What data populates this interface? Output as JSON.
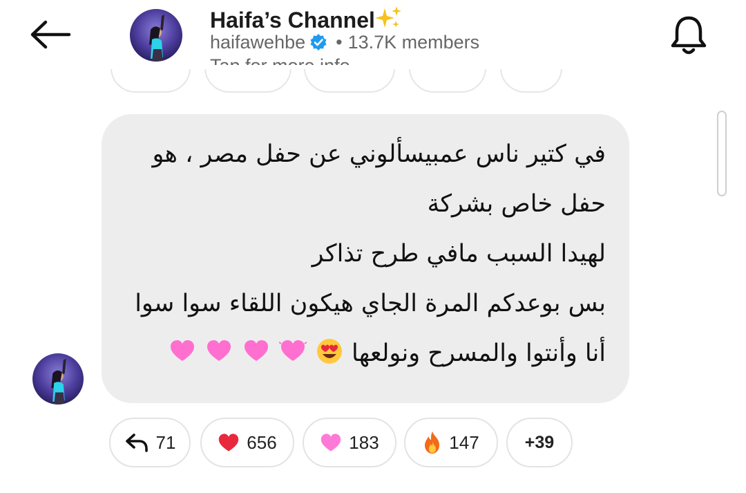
{
  "header": {
    "title": "Haifa’s Channel",
    "title_emoji": "sparkles",
    "handle": "haifawehbe",
    "separator": "•",
    "members": "13.7K members",
    "tap_info": "Tap for more info",
    "back_icon": "arrow-left-icon",
    "bell_icon": "bell-icon"
  },
  "message": {
    "lines": [
      "في كتير ناس عمبيسألوني عن حفل مصر ، هو",
      "حفل خاص بشركة",
      "لهيدا السبب مافي طرح تذاكر",
      "بس بوعدكم المرة الجاي هيكون اللقاء سوا سوا",
      "أنا وأنتوا والمسرح ونولعها"
    ],
    "trailing_emojis": [
      "heart-eyes",
      "pink-heart",
      "pink-heart",
      "pink-heart",
      "pink-heart"
    ]
  },
  "reactions": [
    {
      "icon": "reply-arrow-icon",
      "count": "71"
    },
    {
      "icon": "red-heart-icon",
      "count": "656"
    },
    {
      "icon": "pink-heart-icon",
      "count": "183"
    },
    {
      "icon": "fire-icon",
      "count": "147"
    },
    {
      "icon": "",
      "count": "+39"
    }
  ],
  "colors": {
    "verified_blue": "#1d9bf0",
    "bubble_bg": "#ededed",
    "red_heart": "#e8283d",
    "pink_heart": "#ff7ad6"
  }
}
